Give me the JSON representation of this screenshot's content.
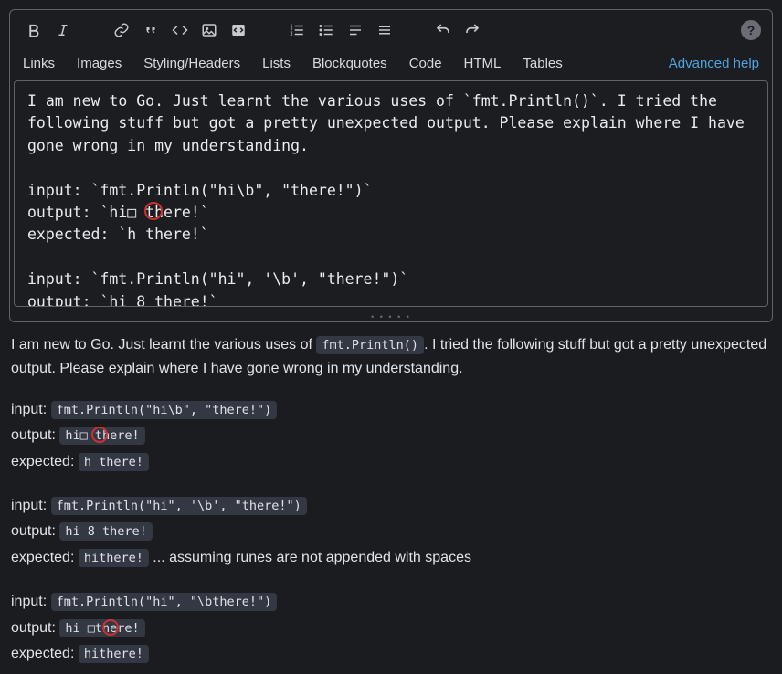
{
  "toolbar": {
    "help_glyph": "?"
  },
  "tabs": {
    "items": [
      "Links",
      "Images",
      "Styling/Headers",
      "Lists",
      "Blockquotes",
      "Code",
      "HTML",
      "Tables"
    ],
    "advanced": "Advanced help"
  },
  "editor": {
    "text": "I am new to Go. Just learnt the various uses of `fmt.Println()`. I tried the following stuff but got a pretty unexpected output. Please explain where I have gone wrong in my understanding.\n\ninput: `fmt.Println(\"hi\\b\", \"there!\")`\noutput: `hi□ there!`\nexpected: `h there!`\n\ninput: `fmt.Println(\"hi\", '\\b', \"there!\")`\noutput: `hi 8 there!`"
  },
  "preview": {
    "intro_pre": "I am new to Go. Just learnt the various uses of ",
    "intro_code": "fmt.Println()",
    "intro_post": ". I tried the following stuff but got a pretty unexpected output. Please explain where I have gone wrong in my understanding.",
    "labels": {
      "input": "input: ",
      "output": "output: ",
      "expected": "expected: "
    },
    "blocks": [
      {
        "input": "fmt.Println(\"hi\\b\", \"there!\")",
        "output": "hi□ there!",
        "expected": "h there!",
        "note": ""
      },
      {
        "input": "fmt.Println(\"hi\", '\\b', \"there!\")",
        "output": "hi 8 there!",
        "expected": "hithere!",
        "note": " ... assuming runes are not appended with spaces"
      },
      {
        "input": "fmt.Println(\"hi\", \"\\bthere!\")",
        "output": "hi □there!",
        "expected": "hithere!",
        "note": ""
      }
    ]
  }
}
